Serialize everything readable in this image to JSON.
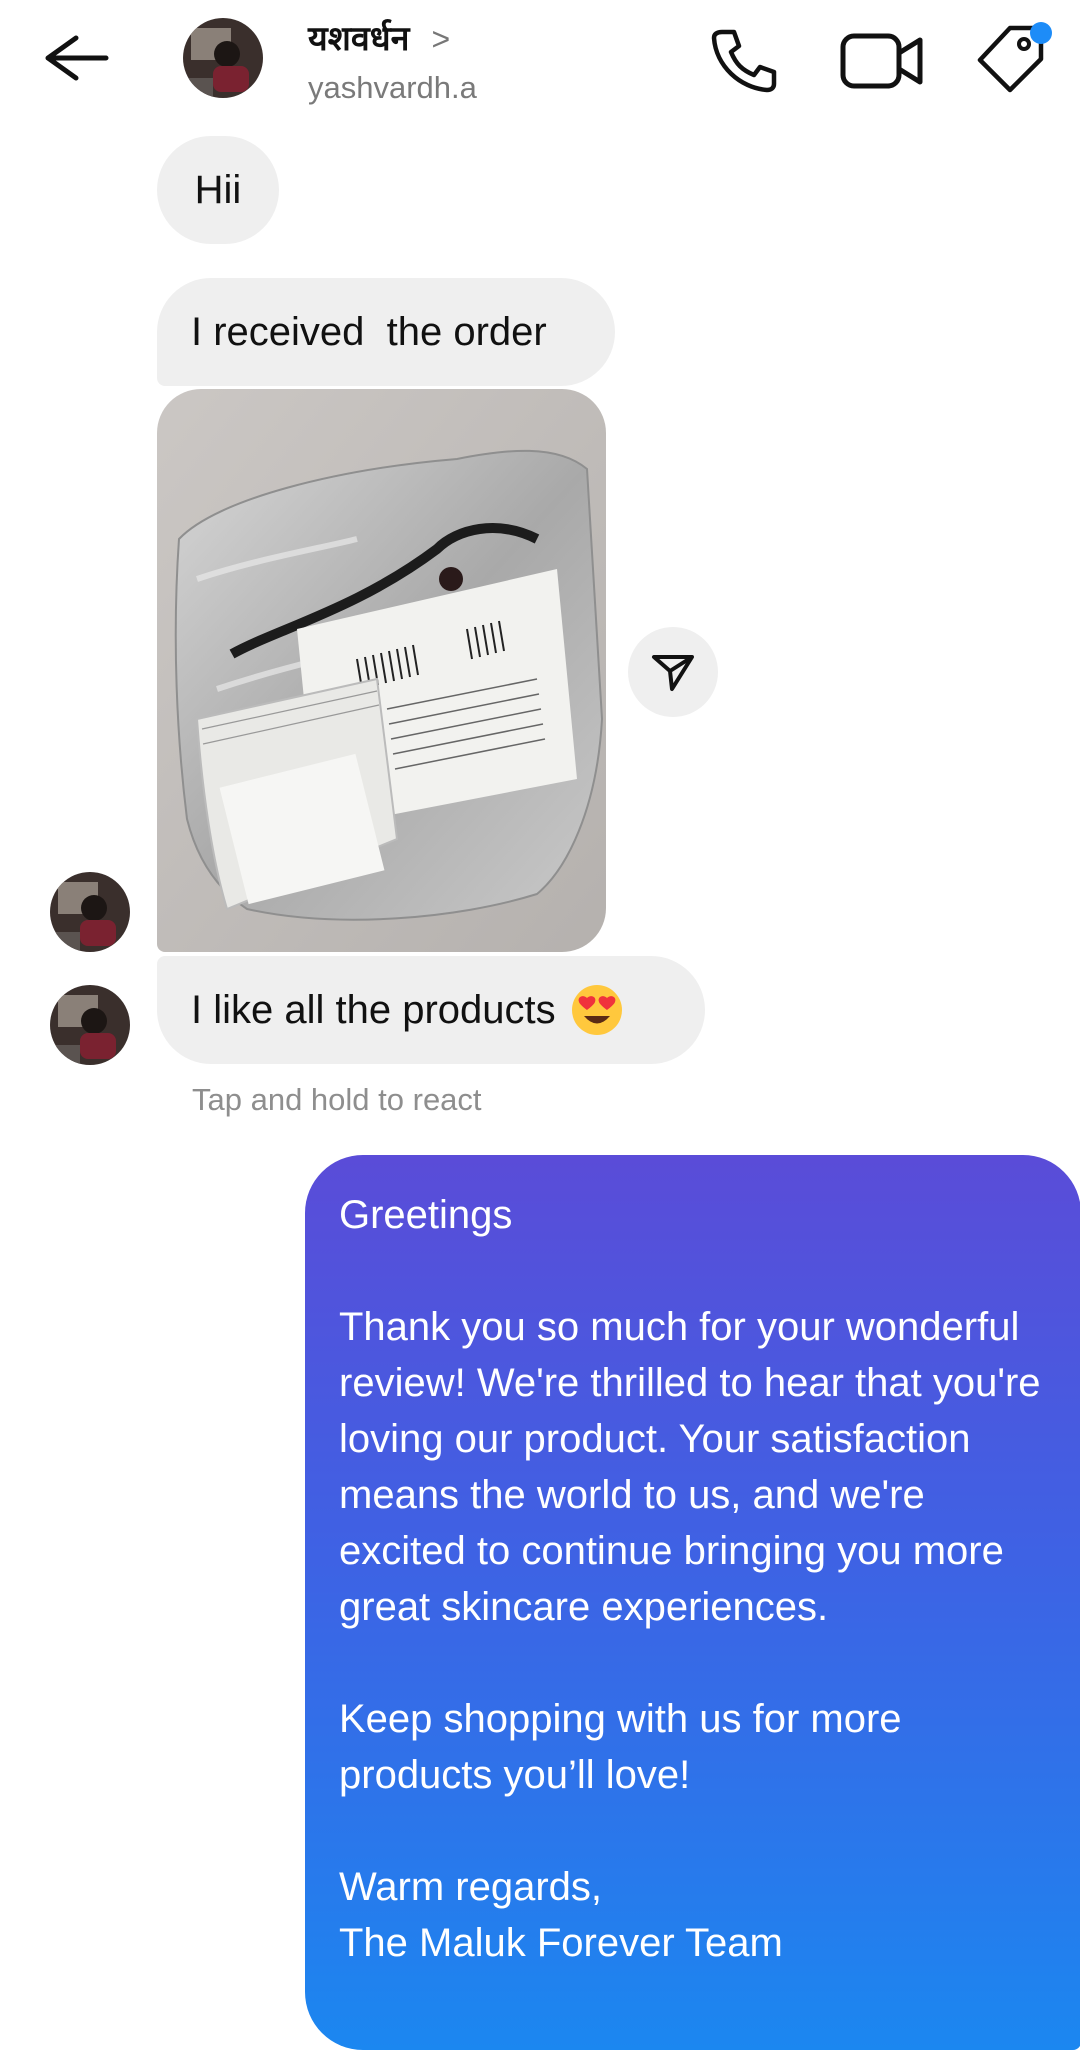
{
  "header": {
    "display_name": "यशवर्धन",
    "name_chevron": ">",
    "username": "yashvardh.a",
    "icons": [
      "back-arrow-icon",
      "phone-icon",
      "video-camera-icon",
      "tag-icon"
    ],
    "notification_dot_color": "#1d8cf8"
  },
  "messages": {
    "incoming": [
      {
        "text": "Hii"
      },
      {
        "text": "I received  the order"
      },
      {
        "image": "package-photo"
      },
      {
        "text": "I like all the products",
        "emoji": "heart-eyes-emoji"
      }
    ],
    "react_hint": "Tap and hold to react",
    "outgoing": {
      "greeting": "Greetings",
      "body": "Thank you so much for your wonderful review! We're thrilled to hear that you're loving our product. Your satisfaction means the world to us, and we're excited to continue bringing you more great skincare experiences.",
      "cta": "Keep shopping with us for more products you’ll love!",
      "signoff": "Warm regards,",
      "team": "The Maluk Forever Team",
      "gradient_colors": [
        "#5a4cd8",
        "#1b87f0"
      ]
    }
  },
  "colors": {
    "incoming_bubble": "#efefef",
    "secondary_text": "#7a7a7a"
  }
}
